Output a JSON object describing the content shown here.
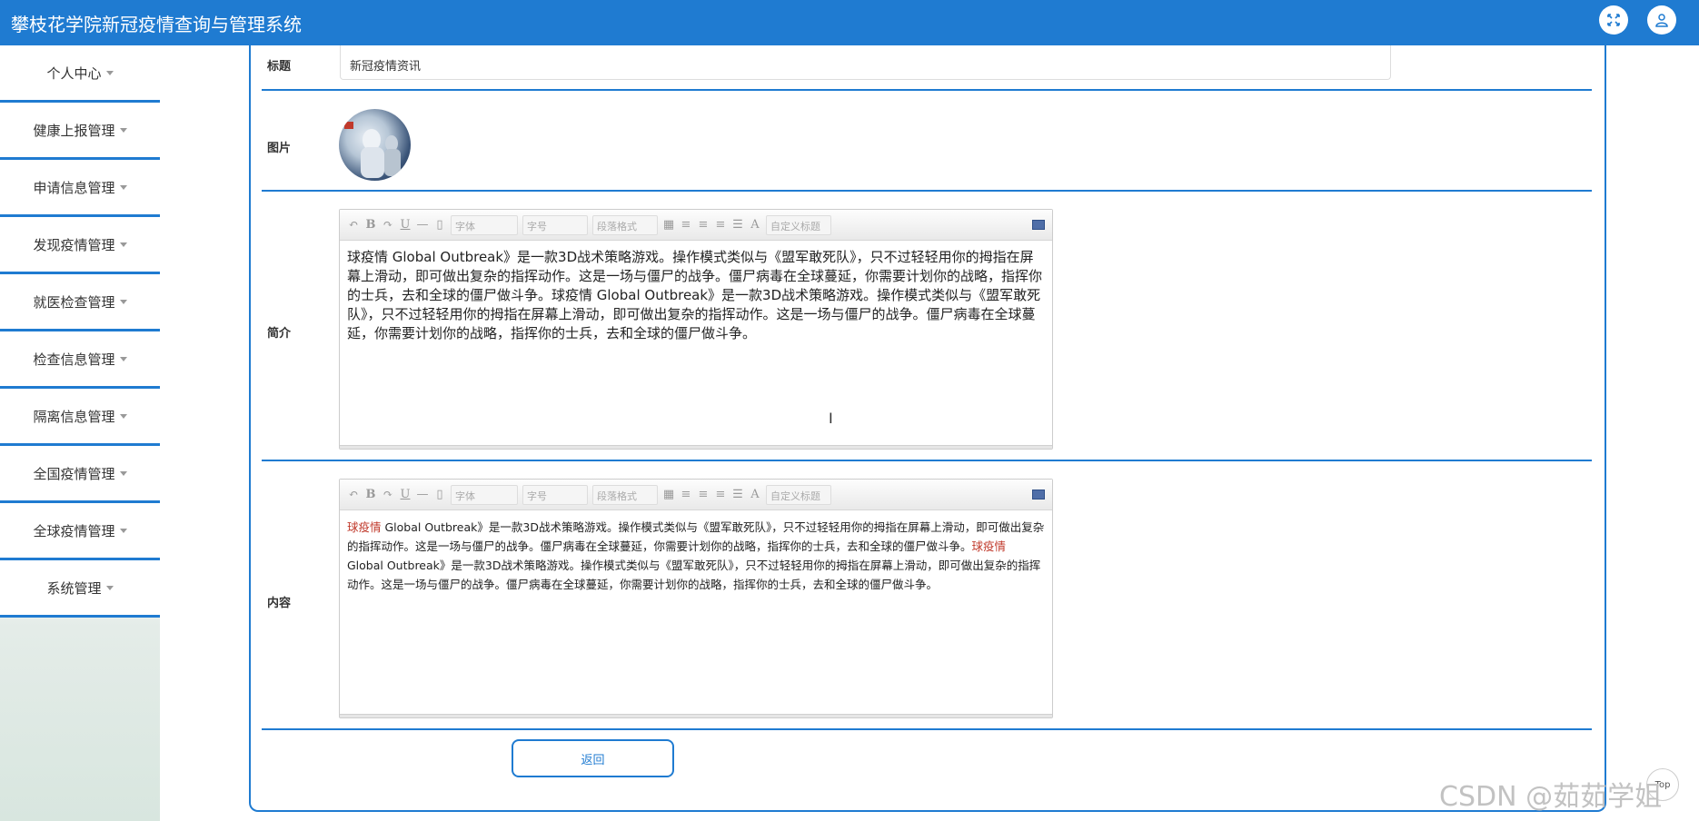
{
  "app": {
    "title": "攀枝花学院新冠疫情查询与管理系统"
  },
  "header": {
    "fullscreen_icon": "expand-icon",
    "user_icon": "user-icon"
  },
  "sidebar": {
    "items": [
      {
        "label": "个人中心"
      },
      {
        "label": "健康上报管理"
      },
      {
        "label": "申请信息管理"
      },
      {
        "label": "发现疫情管理"
      },
      {
        "label": "就医检查管理"
      },
      {
        "label": "检查信息管理"
      },
      {
        "label": "隔离信息管理"
      },
      {
        "label": "全国疫情管理"
      },
      {
        "label": "全球疫情管理"
      },
      {
        "label": "系统管理"
      }
    ]
  },
  "form": {
    "title_label": "标题",
    "title_value": "新冠疫情资讯",
    "image_label": "图片",
    "intro_label": "简介",
    "content_label": "内容",
    "back_button": "返回"
  },
  "editor": {
    "toolbar": {
      "font": "字体",
      "size": "字号",
      "paragraph": "段落格式",
      "custom_title": "自定义标题",
      "bold": "B",
      "italic": "I",
      "underline": "U",
      "font_color": "A"
    },
    "intro_text": "球疫情 Global Outbreak》是一款3D战术策略游戏。操作模式类似与《盟军敢死队》，只不过轻轻用你的拇指在屏幕上滑动，即可做出复杂的指挥动作。这是一场与僵尸的战争。僵尸病毒在全球蔓延，你需要计划你的战略，指挥你的士兵，去和全球的僵尸做斗争。球疫情 Global Outbreak》是一款3D战术策略游戏。操作模式类似与《盟军敢死队》，只不过轻轻用你的拇指在屏幕上滑动，即可做出复杂的指挥动作。这是一场与僵尸的战争。僵尸病毒在全球蔓延，你需要计划你的战略，指挥你的士兵，去和全球的僵尸做斗争。",
    "content_part1_red": "球疫情",
    "content_part1": " Global Outbreak》是一款3D战术策略游戏。操作模式类似与《盟军敢死队》，只不过轻轻用你的拇指在屏幕上滑动，即可做出复杂的指挥动作。这是一场与僵尸的战争。僵尸病毒在全球蔓延，你需要计划你的战略，指挥你的士兵，去和全球的僵尸做斗争。",
    "content_part2_red": "球疫情",
    "content_part2": " Global Outbreak》是一款3D战术策略游戏。操作模式类似与《盟军敢死队》，只不过轻轻用你的拇指在屏幕上滑动，即可做出复杂的指挥动作。这是一场与僵尸的战争。僵尸病毒在全球蔓延，你需要计划你的战略，指挥你的士兵，去和全球的僵尸做斗争。"
  },
  "watermark": "CSDN @茹茹学姐",
  "top_float_label": "Top",
  "colors": {
    "primary": "#1f7bd1",
    "highlight": "#c0392b"
  }
}
